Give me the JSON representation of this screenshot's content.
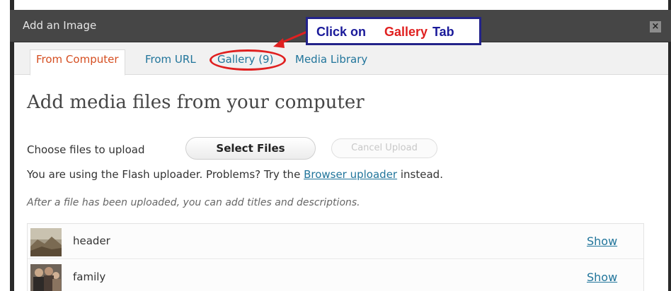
{
  "window": {
    "title": "Add an Image",
    "close_glyph": "×"
  },
  "tabs": [
    {
      "label": "From Computer",
      "active": true
    },
    {
      "label": "From URL",
      "active": false
    },
    {
      "label": "Gallery (9)",
      "active": false
    },
    {
      "label": "Media Library",
      "active": false
    }
  ],
  "annotation": {
    "part1": "Click on ",
    "part2": "Gallery",
    "part3": " Tab",
    "colors": {
      "blue": "#1a1a9a",
      "red": "#e02020"
    }
  },
  "main": {
    "heading": "Add media files from your computer",
    "choose_label": "Choose files to upload",
    "select_button": "Select Files",
    "cancel_button": "Cancel Upload",
    "flash_text_pre": "You are using the Flash uploader. Problems? Try the ",
    "flash_link": "Browser uploader",
    "flash_text_post": " instead.",
    "after_note": "After a file has been uploaded, you can add titles and descriptions."
  },
  "media_items": [
    {
      "name": "header",
      "action": "Show",
      "thumb_icon": "landscape-photo-thumbnail"
    },
    {
      "name": "family",
      "action": "Show",
      "thumb_icon": "family-photo-thumbnail"
    }
  ],
  "colors": {
    "link": "#21759b",
    "active_tab": "#d54e21",
    "titlebar": "#464646"
  }
}
